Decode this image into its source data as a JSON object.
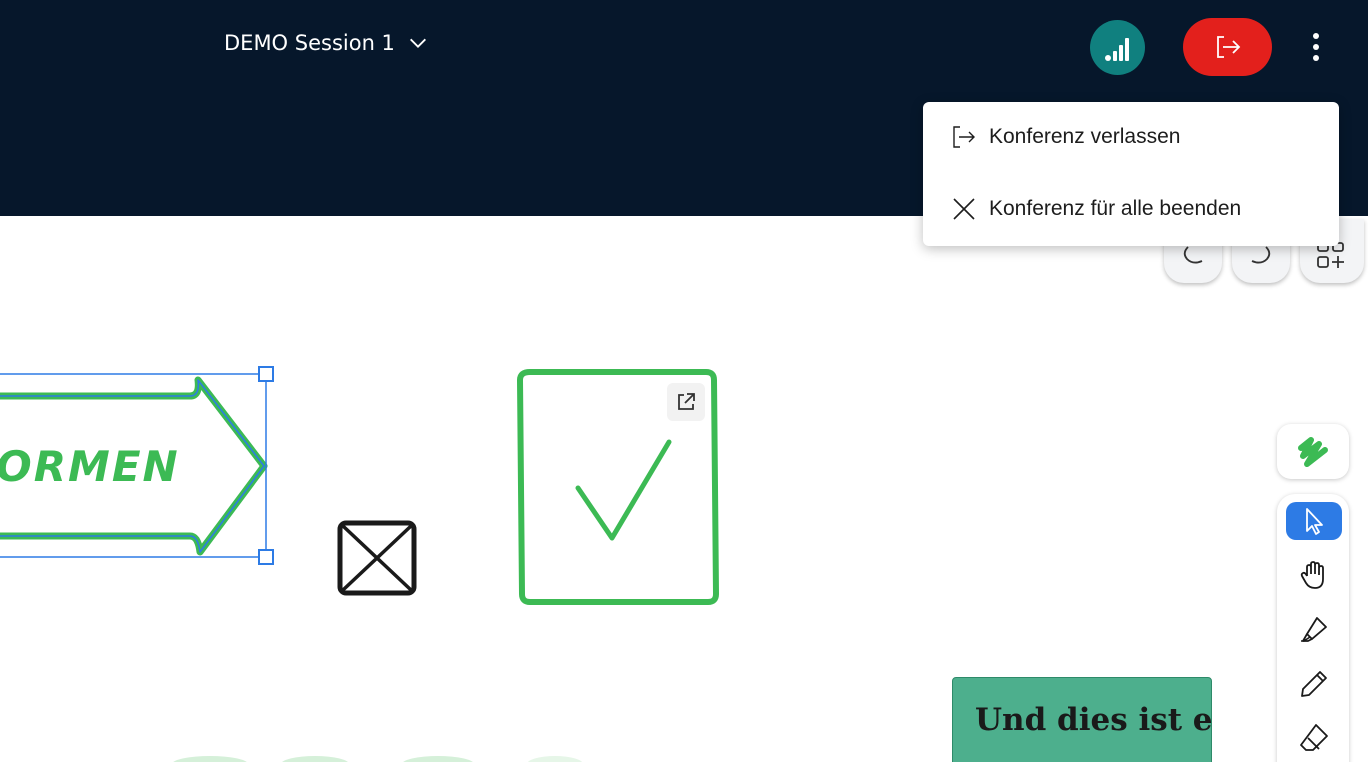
{
  "header": {
    "session_title": "DEMO Session 1"
  },
  "menu": {
    "items": [
      {
        "label": "Konferenz verlassen",
        "icon": "leave-icon"
      },
      {
        "label": "Konferenz für alle beenden",
        "icon": "close-icon"
      }
    ]
  },
  "canvas": {
    "arrow_text": "ORMEN",
    "sticky_text": "Und dies ist eine"
  },
  "toolbar": {
    "tools": [
      "select-tool",
      "hand-tool",
      "highlighter-tool",
      "pen-tool",
      "eraser-tool"
    ],
    "active_tool": "select-tool"
  },
  "colors": {
    "header_bg": "#06172b",
    "leave_button": "#e3201c",
    "signal_button": "#10807f",
    "accent_green": "#3cba54",
    "selection_blue": "#2d7be5",
    "sticky_note": "#4daf8d"
  }
}
